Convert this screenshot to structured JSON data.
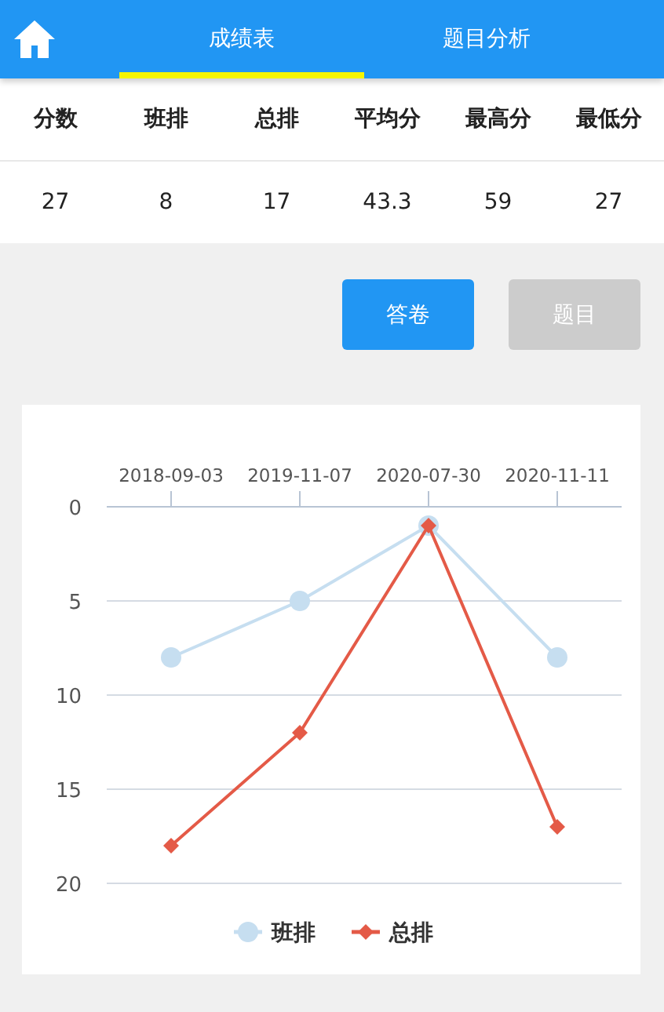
{
  "header": {
    "tabs": [
      {
        "label": "成绩表",
        "selected": true
      },
      {
        "label": "题目分析",
        "selected": false
      }
    ]
  },
  "table": {
    "columns": [
      "分数",
      "班排",
      "总排",
      "平均分",
      "最高分",
      "最低分"
    ],
    "rows": [
      [
        "27",
        "8",
        "17",
        "43.3",
        "59",
        "27"
      ]
    ]
  },
  "buttons": [
    {
      "label": "答卷",
      "disabled": false
    },
    {
      "label": "题目",
      "disabled": true
    }
  ],
  "chart": {
    "chart_data": {
      "type": "line",
      "categories": [
        "2018-09-03",
        "2019-11-07",
        "2020-07-30",
        "2020-11-11"
      ],
      "ylim": [
        20,
        0
      ],
      "yticks": [
        0,
        5,
        10,
        15,
        20
      ],
      "grid": true,
      "legend": "bottom",
      "series": [
        {
          "name": "班排",
          "color": "#c6def0",
          "marker": "circle",
          "values": [
            8,
            5,
            1,
            8
          ]
        },
        {
          "name": "总排",
          "color": "#e45a47",
          "marker": "diamond",
          "values": [
            18,
            12,
            1,
            17
          ]
        }
      ]
    }
  }
}
